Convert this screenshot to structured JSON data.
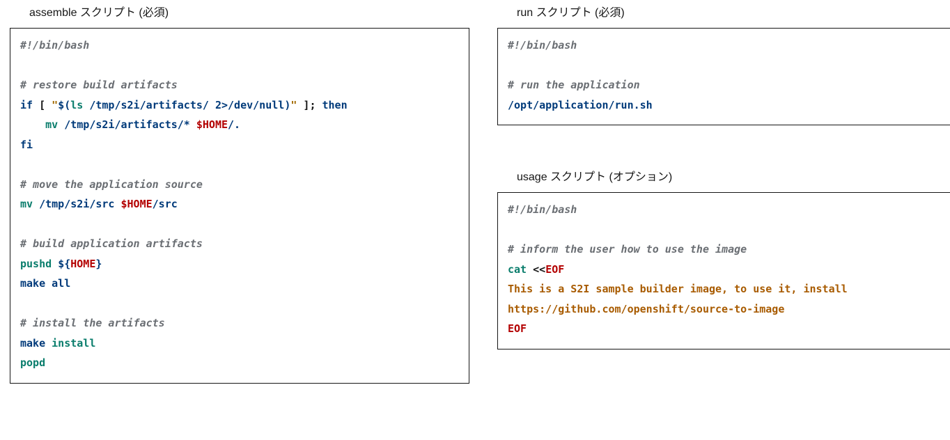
{
  "sections": {
    "assemble": {
      "title": "assemble スクリプト (必須)"
    },
    "run": {
      "title": "run スクリプト (必須)"
    },
    "usage": {
      "title": "usage スクリプト (オプション)"
    }
  },
  "code": {
    "assemble": {
      "shebang": "#!/bin/bash",
      "c1": "# restore build artifacts",
      "if": "if",
      "lb": "[",
      "q1": "\"",
      "do": "$(",
      "ls": "ls",
      "p1": "/tmp/s2i/artifacts/",
      "two": "2",
      "devnull": ">/dev/null",
      "dc": ")",
      "q2": "\"",
      "rb": "]",
      "sc": ";",
      "then": "then",
      "mv1": "mv",
      "p2": "/tmp/s2i/artifacts/*",
      "home1": "$HOME",
      "slashdot": "/.",
      "fi": "fi",
      "c2": "# move the application source",
      "mv2": "mv",
      "p3": "/tmp/s2i/src",
      "home2": "$HOME",
      "slashsrc": "/src",
      "c3": "# build application artifacts",
      "pushd": "pushd",
      "vo": "${",
      "home3": "HOME",
      "vc": "}",
      "make": "make",
      "all": "all",
      "c4": "# install the artifacts",
      "make2": "make",
      "install": "install",
      "popd": "popd"
    },
    "run": {
      "shebang": "#!/bin/bash",
      "c1": "# run the application",
      "path": "/opt/application/run.sh"
    },
    "usage": {
      "shebang": "#!/bin/bash",
      "c1": "# inform the user how to use the image",
      "cat": "cat",
      "hh": "<<",
      "eof1": "EOF",
      "line1": "This is a S2I sample builder image, to use it, install",
      "line2": "https://github.com/openshift/source-to-image",
      "eof2": "EOF"
    }
  }
}
